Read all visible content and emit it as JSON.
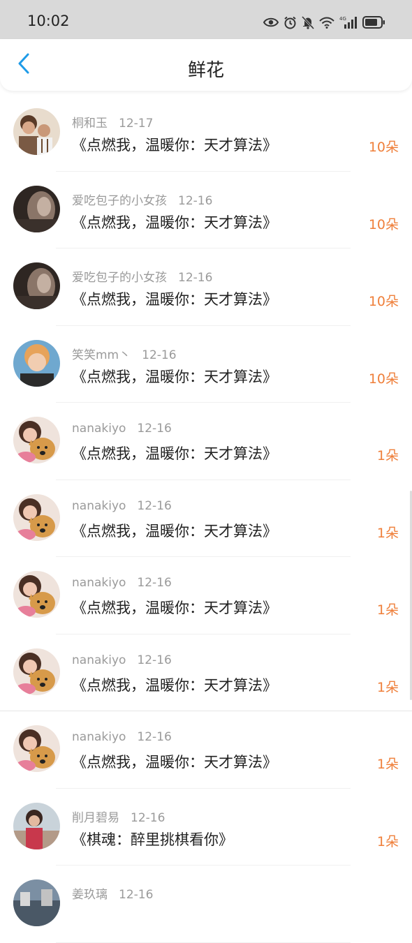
{
  "status_bar": {
    "time": "10:02",
    "network_label": "4G",
    "icons": [
      "eye-icon",
      "alarm-icon",
      "mute-icon",
      "wifi-icon",
      "signal-icon",
      "battery-icon"
    ]
  },
  "header": {
    "back_icon": "chevron-left-icon",
    "title": "鲜花"
  },
  "colors": {
    "accent": "#1e9be8",
    "amount": "#ef7f3a",
    "status_bar_bg": "#d9d9d9"
  },
  "records": [
    {
      "user": "桐和玉",
      "date": "12-17",
      "book": "《点燃我，温暖你：天才算法》",
      "amount": "10朵"
    },
    {
      "user": "爱吃包子的小女孩",
      "date": "12-16",
      "book": "《点燃我，温暖你：天才算法》",
      "amount": "10朵"
    },
    {
      "user": "爱吃包子的小女孩",
      "date": "12-16",
      "book": "《点燃我，温暖你：天才算法》",
      "amount": "10朵"
    },
    {
      "user": "笑笑mm丶",
      "date": "12-16",
      "book": "《点燃我，温暖你：天才算法》",
      "amount": "10朵"
    },
    {
      "user": "nanakiyo",
      "date": "12-16",
      "book": "《点燃我，温暖你：天才算法》",
      "amount": "1朵"
    },
    {
      "user": "nanakiyo",
      "date": "12-16",
      "book": "《点燃我，温暖你：天才算法》",
      "amount": "1朵"
    },
    {
      "user": "nanakiyo",
      "date": "12-16",
      "book": "《点燃我，温暖你：天才算法》",
      "amount": "1朵"
    },
    {
      "user": "nanakiyo",
      "date": "12-16",
      "book": "《点燃我，温暖你：天才算法》",
      "amount": "1朵"
    },
    {
      "user": "nanakiyo",
      "date": "12-16",
      "book": "《点燃我，温暖你：天才算法》",
      "amount": "1朵"
    },
    {
      "user": "削月碧易",
      "date": "12-16",
      "book": "《棋魂：醉里挑棋看你》",
      "amount": "1朵"
    },
    {
      "user": "姜玖璃",
      "date": "12-16",
      "book": "",
      "amount": ""
    }
  ]
}
